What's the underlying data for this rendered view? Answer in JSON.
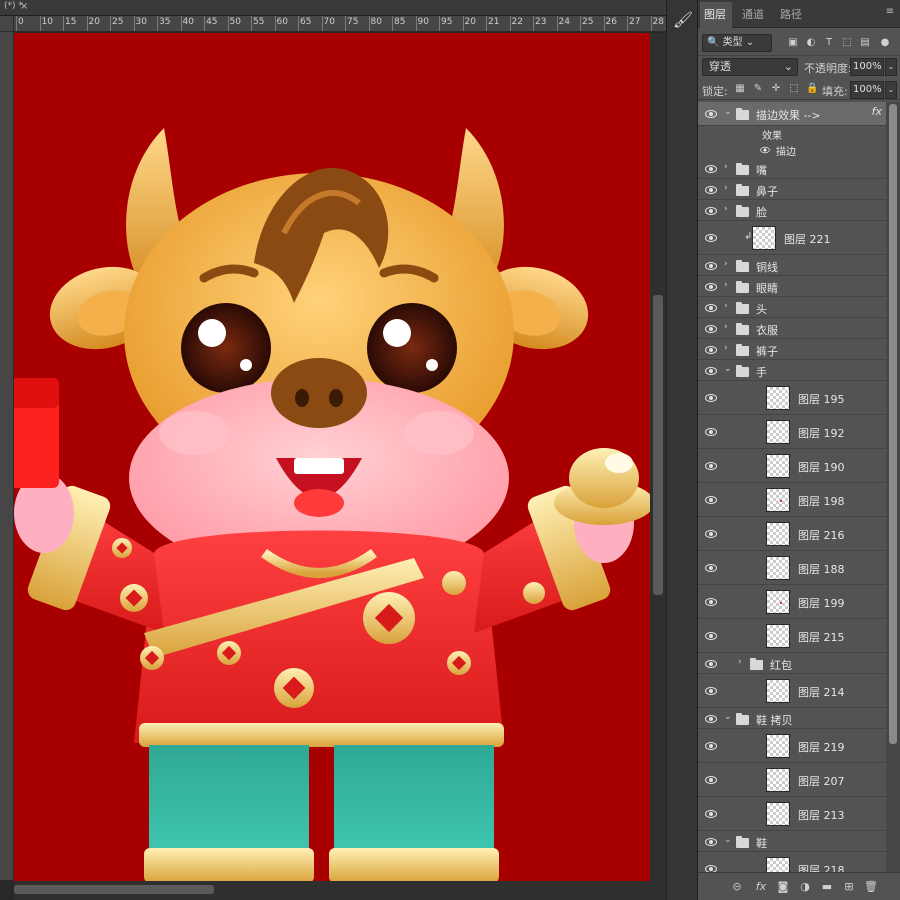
{
  "document_tab": {
    "label": "(*) *",
    "close": "×"
  },
  "ruler_labels": [
    "0",
    "10",
    "15",
    "20",
    "25",
    "30",
    "35",
    "40",
    "45",
    "50",
    "55",
    "60",
    "65",
    "70",
    "75",
    "80",
    "85",
    "90",
    "95",
    "20",
    "21",
    "22",
    "23",
    "24",
    "25",
    "26",
    "27",
    "28"
  ],
  "panel": {
    "tabs": [
      "图层",
      "通道",
      "路径"
    ],
    "menu": "≡",
    "filter_kind": "类型",
    "blend_mode": "穿透",
    "opacity_label": "不透明度:",
    "opacity_value": "100%",
    "lock_label": "锁定:",
    "fill_label": "填充:",
    "fill_value": "100%"
  },
  "layers": [
    {
      "type": "group",
      "name": "描边效果 -->",
      "expanded": true,
      "selected": true,
      "fx": "fx",
      "indent": 0
    },
    {
      "type": "effect-header",
      "name": "效果",
      "indent": 1
    },
    {
      "type": "effect",
      "name": "描边",
      "indent": 2
    },
    {
      "type": "group",
      "name": "嘴",
      "expanded": false,
      "indent": 0
    },
    {
      "type": "group",
      "name": "鼻子",
      "expanded": false,
      "indent": 0
    },
    {
      "type": "group",
      "name": "脸",
      "expanded": false,
      "indent": 0
    },
    {
      "type": "layer",
      "name": "图层 221",
      "clip": true,
      "indent": 0
    },
    {
      "type": "group",
      "name": "铜线",
      "expanded": false,
      "indent": 0
    },
    {
      "type": "group",
      "name": "眼睛",
      "expanded": false,
      "indent": 0
    },
    {
      "type": "group",
      "name": "头",
      "expanded": false,
      "indent": 0
    },
    {
      "type": "group",
      "name": "衣服",
      "expanded": false,
      "indent": 0
    },
    {
      "type": "group",
      "name": "裤子",
      "expanded": false,
      "indent": 0
    },
    {
      "type": "group",
      "name": "手",
      "expanded": true,
      "indent": 0
    },
    {
      "type": "layer",
      "name": "图层 195",
      "indent": 1
    },
    {
      "type": "layer",
      "name": "图层 192",
      "indent": 1
    },
    {
      "type": "layer",
      "name": "图层 190",
      "indent": 1
    },
    {
      "type": "layer",
      "name": "图层 198",
      "indent": 1,
      "dot": true
    },
    {
      "type": "layer",
      "name": "图层 216",
      "indent": 1
    },
    {
      "type": "layer",
      "name": "图层 188",
      "indent": 1
    },
    {
      "type": "layer",
      "name": "图层 199",
      "indent": 1,
      "dot": true
    },
    {
      "type": "layer",
      "name": "图层 215",
      "indent": 1
    },
    {
      "type": "group",
      "name": "红包",
      "expanded": false,
      "indent": 1
    },
    {
      "type": "layer",
      "name": "图层 214",
      "indent": 1
    },
    {
      "type": "group",
      "name": "鞋 拷贝",
      "expanded": true,
      "indent": 0
    },
    {
      "type": "layer",
      "name": "图层 219",
      "indent": 1
    },
    {
      "type": "layer",
      "name": "图层 207",
      "indent": 1
    },
    {
      "type": "layer",
      "name": "图层 213",
      "indent": 1
    },
    {
      "type": "group",
      "name": "鞋",
      "expanded": true,
      "indent": 0
    },
    {
      "type": "layer",
      "name": "图层 218",
      "indent": 1
    }
  ],
  "bottom_icons": [
    "link-icon",
    "fx-icon",
    "mask-icon",
    "adjustment-icon",
    "new-group-icon",
    "new-layer-icon",
    "trash-icon"
  ],
  "colors": {
    "canvas_bg": "#a80000",
    "panel_bg": "#535353"
  }
}
